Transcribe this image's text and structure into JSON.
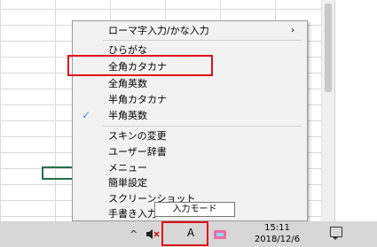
{
  "menu": {
    "items": [
      {
        "label": "ローマ字入力/かな入力",
        "arrow": "›",
        "checked": false
      },
      {
        "label": "ひらがな",
        "checked": false
      },
      {
        "label": "全角カタカナ",
        "checked": false
      },
      {
        "label": "全角英数",
        "checked": false
      },
      {
        "label": "半角カタカナ",
        "checked": false
      },
      {
        "label": "半角英数",
        "checked": true,
        "check_glyph": "✓"
      },
      {
        "label": "スキンの変更",
        "checked": false
      },
      {
        "label": "ユーザー辞書",
        "checked": false
      },
      {
        "label": "メニュー",
        "checked": false
      },
      {
        "label": "簡単設定",
        "checked": false
      },
      {
        "label": "スクリーンショット",
        "checked": false
      },
      {
        "label": "手書き入力",
        "checked": false
      }
    ]
  },
  "tooltip": {
    "text": "入力モード"
  },
  "taskbar": {
    "chevron": "^",
    "volume_icon": "speaker-muted-icon",
    "ime_mode": "A",
    "time": "15:11",
    "date": "2018/12/6"
  },
  "colors": {
    "highlight": "#e0101a",
    "menu_bg": "#f2f2f2",
    "taskbar_bg": "#d7d7d7",
    "check": "#3b8fd6"
  }
}
